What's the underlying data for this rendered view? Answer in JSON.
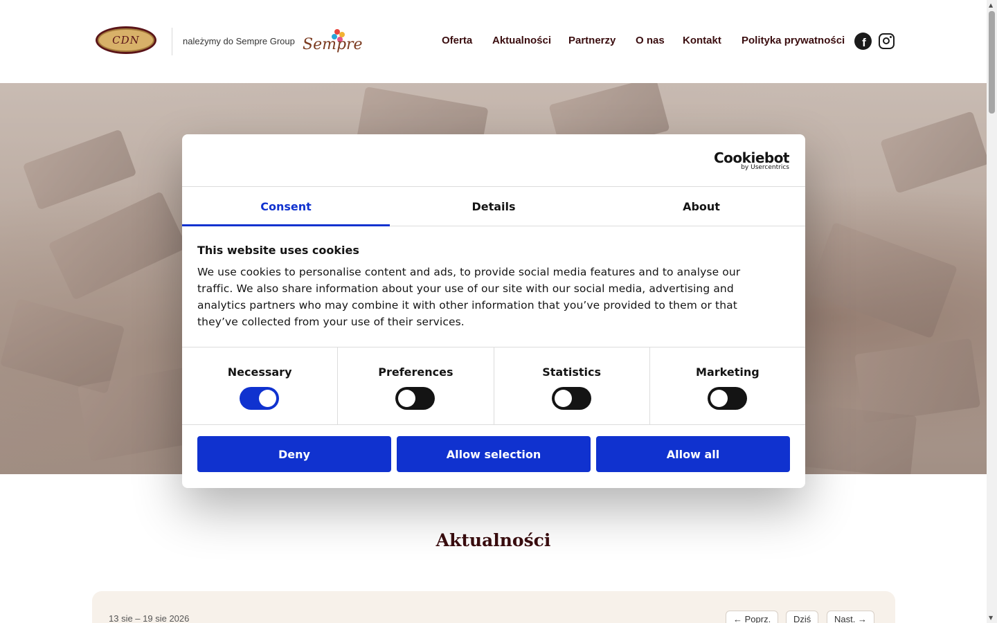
{
  "header": {
    "logo_text": "CDN",
    "belong_text": "należymy do Sempre Group",
    "sempre_logo_text": "Sempre",
    "nav": [
      "Oferta",
      "Aktualności",
      "Partnerzy",
      "O nas",
      "Kontakt",
      "Polityka prywatności"
    ],
    "social": [
      "facebook-icon",
      "instagram-icon"
    ]
  },
  "cookie_dialog": {
    "brand": "Cookiebot",
    "brand_sub": "by Usercentrics",
    "tabs": [
      "Consent",
      "Details",
      "About"
    ],
    "active_tab": "Consent",
    "heading": "This website uses cookies",
    "text": "We use cookies to personalise content and ads, to provide social media features and to analyse our traffic. We also share information about your use of our site with our social media, advertising and analytics partners who may combine it with other information that you’ve provided to them or that they’ve collected from your use of their services.",
    "toggles": [
      {
        "label": "Necessary",
        "on": true
      },
      {
        "label": "Preferences",
        "on": false
      },
      {
        "label": "Statistics",
        "on": false
      },
      {
        "label": "Marketing",
        "on": false
      }
    ],
    "buttons": [
      "Deny",
      "Allow selection",
      "Allow all"
    ],
    "accent_color": "#1032cf"
  },
  "section": {
    "title": "Aktualności",
    "date_range": "13 sie – 19 sie 2026",
    "prev_label": "← Poprz.",
    "today_label": "Dziś",
    "next_label": "Nast. →"
  },
  "colors": {
    "brand_dark": "#3a0d0f",
    "panel_bg": "#f7f1ea"
  }
}
